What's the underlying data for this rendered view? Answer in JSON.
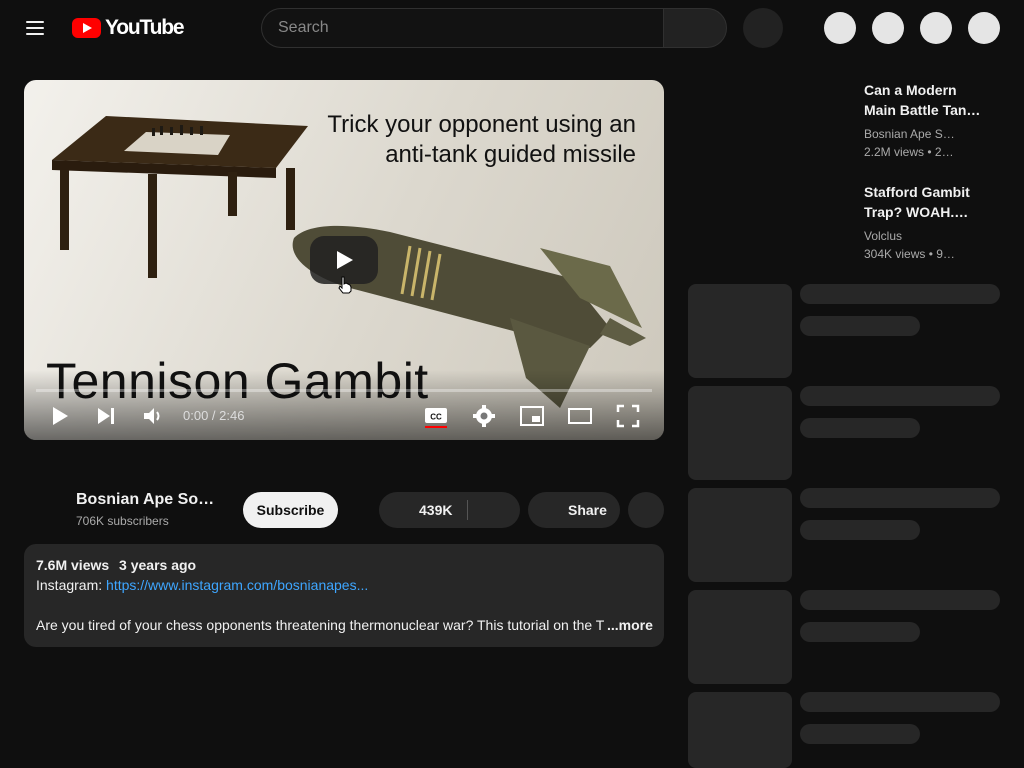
{
  "header": {
    "logo_text": "YouTube",
    "search_placeholder": "Search"
  },
  "player": {
    "thumb_line1": "Trick your opponent using an",
    "thumb_line2": "anti-tank guided missile",
    "thumb_title": "Tennison Gambit",
    "time": "0:00 / 2:46"
  },
  "channel": {
    "name": "Bosnian Ape So…",
    "subscribers": "706K subscribers",
    "subscribe_label": "Subscribe"
  },
  "actions": {
    "likes": "439K",
    "share_label": "Share"
  },
  "description": {
    "views": "7.6M views",
    "age": "3 years ago",
    "instagram_label": "Instagram:",
    "instagram_link": "https://www.instagram.com/bosnianapes...",
    "body": "Are you tired of your chess opponents threatening thermonuclear war? This tutorial on the T",
    "more_label": "...more"
  },
  "recommendations": [
    {
      "title_line1": "Can a Modern",
      "title_line2": "Main Battle Tan…",
      "channel": "Bosnian Ape S…",
      "views": "2.2M views",
      "age": "• 2…"
    },
    {
      "title_line1": "Stafford Gambit",
      "title_line2": "Trap? WOAH.…",
      "channel": "Volclus",
      "views": "304K views",
      "age": "• 9…"
    }
  ],
  "colors": {
    "brand_red": "#ff0000",
    "link_blue": "#3ea6ff",
    "background": "#0f0f0f",
    "surface": "#272727"
  }
}
